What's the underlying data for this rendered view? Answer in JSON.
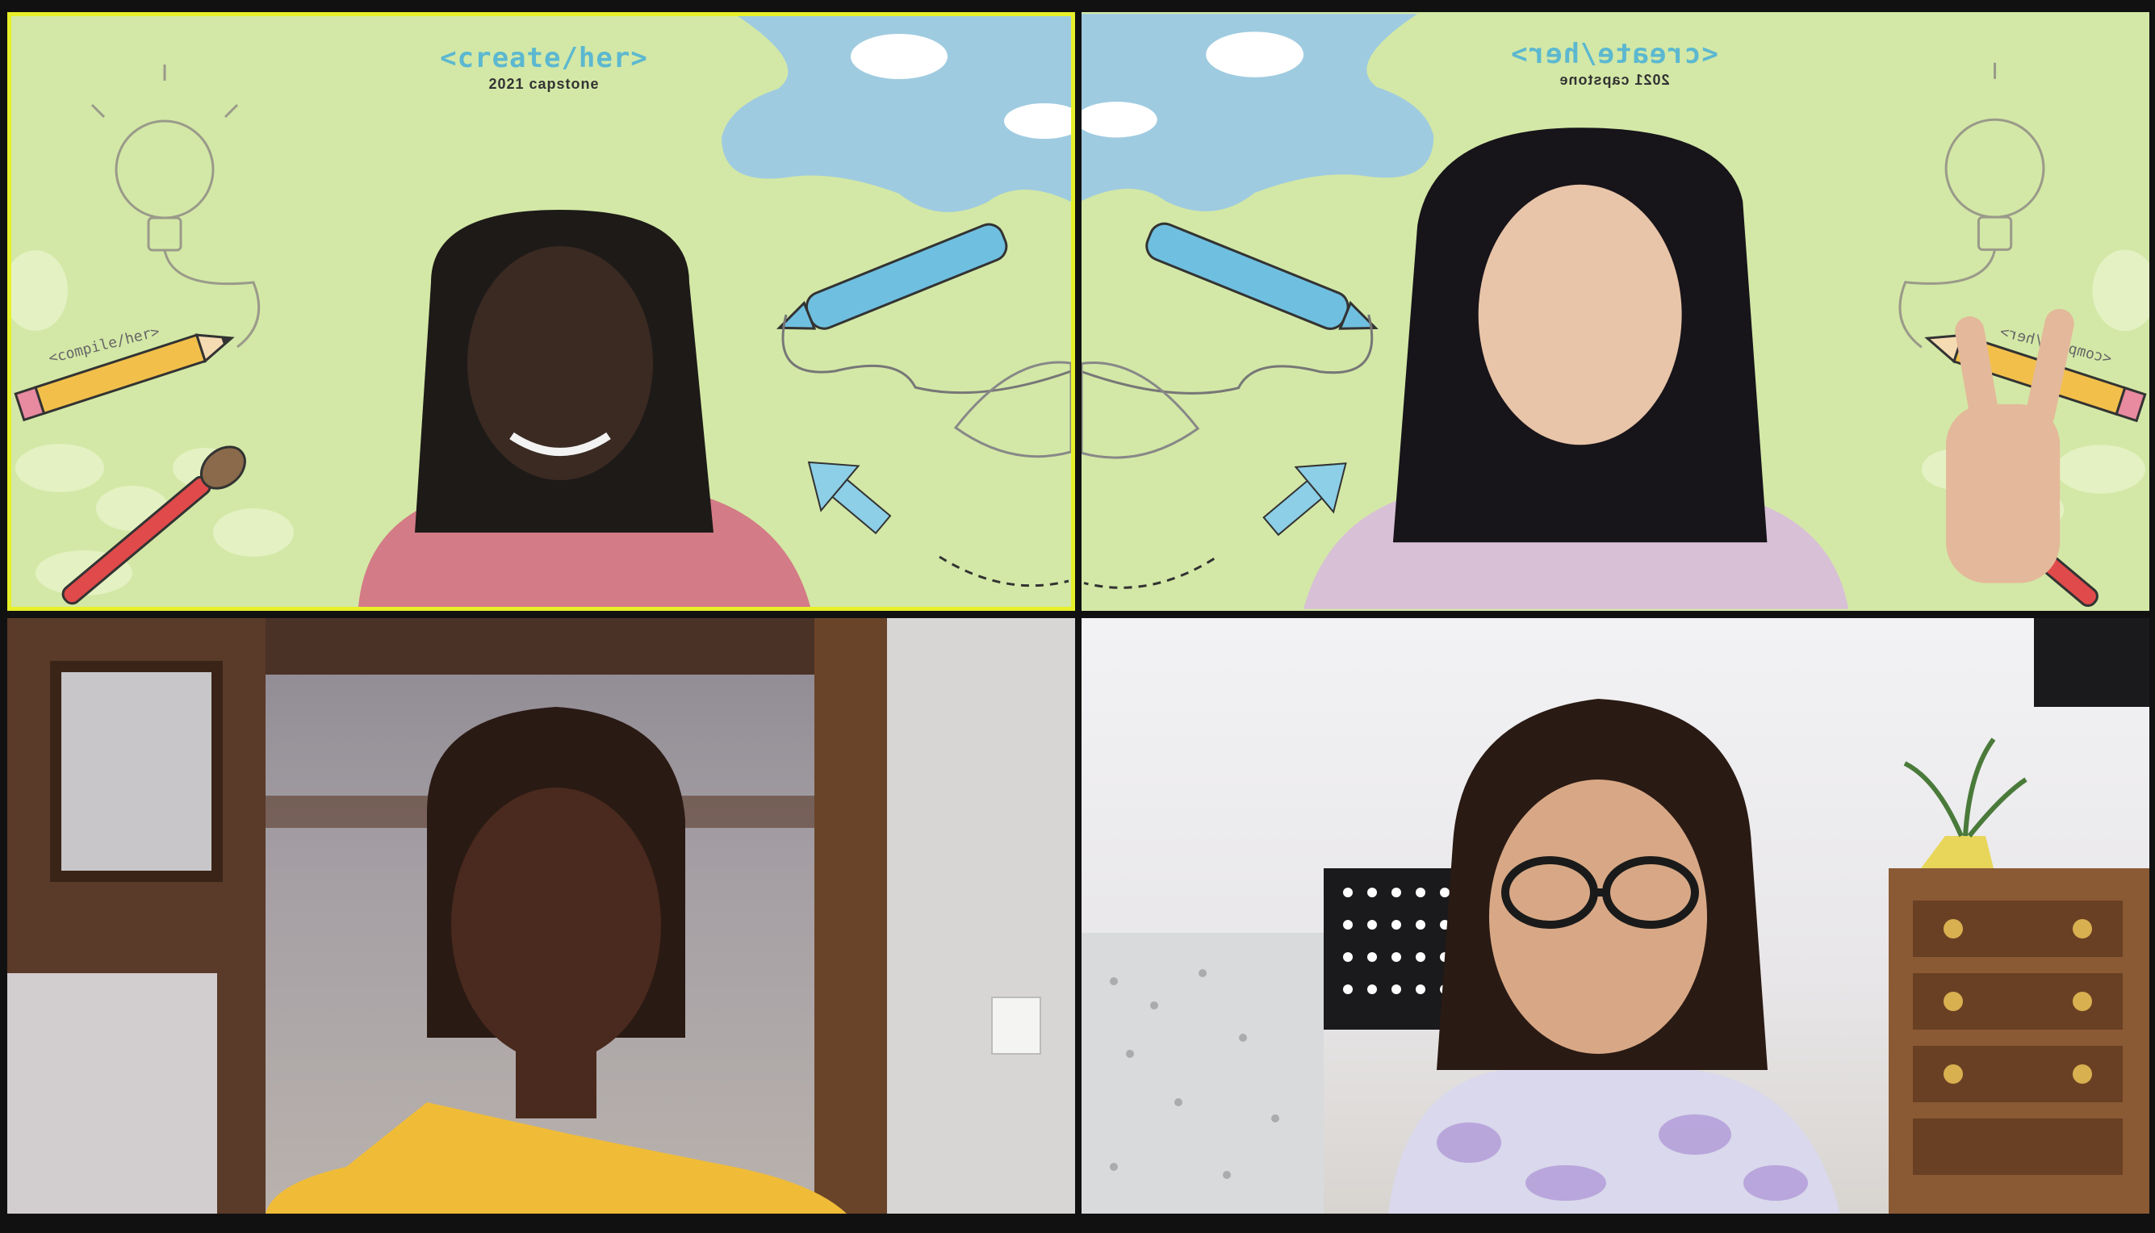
{
  "meeting": {
    "layout": "gallery-2x2",
    "active_speaker_color": "#e7f02a"
  },
  "virtual_background": {
    "title": "<create/her>",
    "subtitle": "2021 capstone",
    "pencil_label": "<compile/her>",
    "title_color": "#5cb8d0",
    "background_color": "#d3e8a6"
  },
  "tiles": [
    {
      "id": "participant-1",
      "active_speaker": true,
      "background": "virtual",
      "mirrored": false
    },
    {
      "id": "participant-2",
      "active_speaker": false,
      "background": "virtual",
      "mirrored": true
    },
    {
      "id": "participant-3",
      "active_speaker": false,
      "background": "room",
      "mirrored": false
    },
    {
      "id": "participant-4",
      "active_speaker": false,
      "background": "room",
      "mirrored": false
    }
  ]
}
